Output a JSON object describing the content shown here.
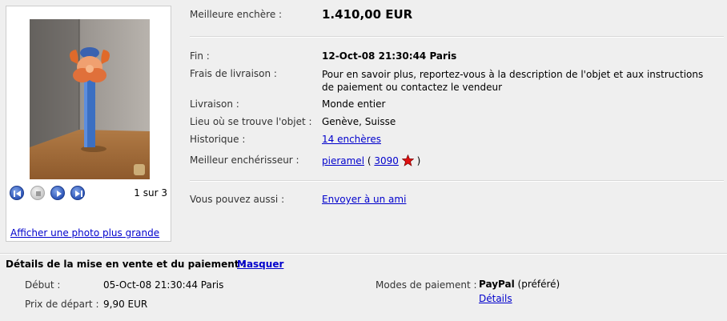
{
  "gallery": {
    "counter": "1 sur 3",
    "enlarge_link": "Afficher une photo plus grande",
    "controls": [
      "previous",
      "stop",
      "play",
      "next"
    ]
  },
  "item": {
    "best_bid_label": "Meilleure enchère :",
    "best_bid_value": "1.410,00 EUR",
    "end_label": "Fin :",
    "end_value": "12-Oct-08 21:30:44 Paris",
    "shipping_label": "Frais de livraison :",
    "shipping_value": "Pour en savoir plus, reportez-vous à la description de l'objet et aux instructions de paiement ou contactez le vendeur",
    "delivery_label": "Livraison :",
    "delivery_value": "Monde entier",
    "location_label": "Lieu où se trouve l'objet :",
    "location_value": "Genève, Suisse",
    "history_label": "Historique :",
    "history_link": "14 enchères",
    "bidder_label": "Meilleur enchérisseur :",
    "bidder_name": "pieramel",
    "bidder_open": "(",
    "bidder_score": "3090",
    "bidder_close": ")",
    "also_label": "Vous pouvez aussi :",
    "also_link": "Envoyer à un ami"
  },
  "summary": {
    "title": "Détails de la mise en vente et du paiement :",
    "toggle": "Masquer",
    "start_label": "Début :",
    "start_value": "05-Oct-08 21:30:44 Paris",
    "price_label": "Prix de départ :",
    "price_value": "9,90 EUR",
    "payment_label": "Modes de paiement :",
    "payment_method": "PayPal",
    "payment_pref": "(préféré)",
    "payment_details": "Détails"
  },
  "colors": {
    "background": "#efefef",
    "link": "#0000cc",
    "star": "#e01010"
  }
}
